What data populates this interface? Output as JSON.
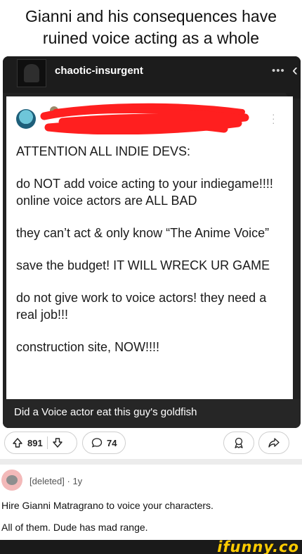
{
  "caption": "Gianni and his consequences have ruined voice acting as a whole",
  "post": {
    "username": "chaotic-insurgent",
    "more_icon": "ellipsis-icon",
    "back_icon": "chevron-left-icon",
    "screenshot_lines": [
      "ATTENTION ALL INDIE DEVS:",
      "do NOT add voice acting to your indiegame!!!! online voice actors are ALL BAD",
      "they can’t act & only know “The Anime Voice”",
      "save the budget! IT WILL WRECK UR GAME",
      "do not give work to voice actors! they need a real job!!!",
      "construction site, NOW!!!!"
    ],
    "subtitle": "Did a Voice actor eat this guy's goldfish"
  },
  "actions": {
    "upvotes": "891",
    "comments": "74",
    "upvote_icon": "upvote-arrow-icon",
    "downvote_icon": "downvote-arrow-icon",
    "comment_icon": "comment-bubble-icon",
    "award_icon": "award-icon",
    "share_icon": "share-arrow-icon"
  },
  "comment": {
    "author": "[deleted]",
    "age": "· 1y",
    "text_lines": [
      "Hire Gianni Matragrano to voice your characters.",
      "All of them. Dude has mad range."
    ]
  },
  "watermark": "ifunny.co",
  "colors": {
    "scribble": "#ff1f1f",
    "watermark": "#ffcc00",
    "dark_card": "#222222"
  }
}
